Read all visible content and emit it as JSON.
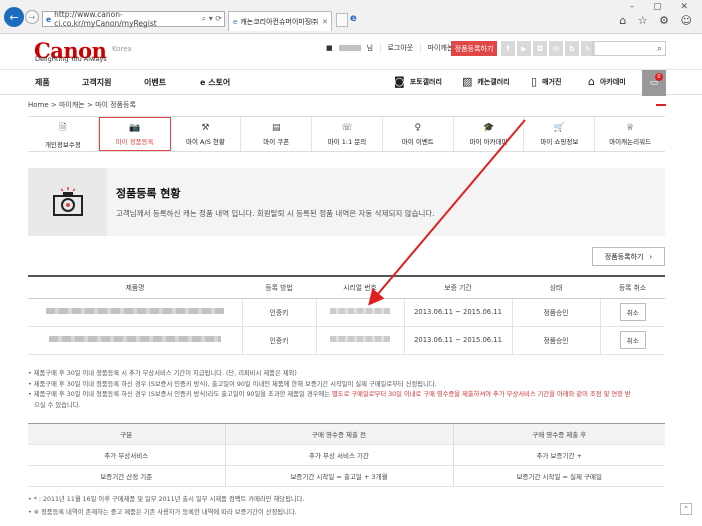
{
  "browser": {
    "url": "http://www.canon-ci.co.kr/myCanon/myRegist",
    "tab_title": "캐논코리아컨슈머이미징㈜",
    "window_controls": "–  ▢  ✕",
    "tools": "⌂ ☆ ⚙ ☺"
  },
  "header": {
    "logo": "Canon",
    "region": "Korea",
    "tagline": "Delighting You Always",
    "user_suffix": "님",
    "logout": "로그아웃",
    "mycanon": "마이캐논",
    "register_button": "정품등록하기",
    "sns": [
      "f",
      "▶",
      "◘",
      "✉",
      "b",
      "✎"
    ],
    "search_icon": "⌕"
  },
  "gnb": {
    "left": [
      "제품",
      "고객지원",
      "이벤트",
      "e 스토어"
    ],
    "right": [
      "포토갤러리",
      "캐논갤러리",
      "매거진",
      "아카데미"
    ],
    "cart_badge": "0"
  },
  "breadcrumb": "Home  >  마이캐논  >  마이 정품등록",
  "subnav": [
    {
      "label": "개인정보수정",
      "icon": "🗎"
    },
    {
      "label": "마이 정품등록",
      "icon": "📷",
      "active": true
    },
    {
      "label": "마이 A/S 현황",
      "icon": "⚒"
    },
    {
      "label": "마이 쿠폰",
      "icon": "▤"
    },
    {
      "label": "마이 1:1 문의",
      "icon": "☏"
    },
    {
      "label": "마이 이벤트",
      "icon": "♀"
    },
    {
      "label": "마이 아카데미",
      "icon": "🎓"
    },
    {
      "label": "마이 쇼핑정보",
      "icon": "🛒"
    },
    {
      "label": "마이캐논리워드",
      "icon": "♕"
    }
  ],
  "summary": {
    "title": "정품등록 현황",
    "desc": "고객님께서 등록하신 캐논 정품 내역 입니다. 회원탈퇴 시 등록된 정품 내역은 자동 삭제되지 않습니다."
  },
  "register_btn2": "정품등록하기",
  "table": {
    "headers": [
      "제품명",
      "등록 방법",
      "시리얼 번호",
      "보증 기간",
      "상태",
      "등록 취소"
    ],
    "rows": [
      {
        "method": "인증키",
        "period": "2013.06.11 ~ 2015.06.11",
        "status": "정품승인",
        "cancel": "취소"
      },
      {
        "method": "인증키",
        "period": "2013.06.11 ~ 2015.06.11",
        "status": "정품승인",
        "cancel": "취소"
      }
    ]
  },
  "notes": [
    "제품구매 후 30일 이내 정품등록 시 추가 무상서비스 기간이 지급됩니다. (단, 리퍼비시 제품은 제외)",
    "제품구매 후 30일 이내 정품등록 하신 경우 (S보증서 인증키 방식), 출고일이 90일 이내인 제품에 한해 보증기간 시작일이 실제 구매일로부터 산정됩니다.",
    "제품구매 후 30일 이내 정품등록 하신 경우 (S보증서 인증키 방식)라도 출고일이 90일을 초과한 제품일 경우에는 ",
    "별도로 구매일로부터 30일 이내로 구매 영수증을 제출하셔야 추가 무상서비스 기간을 아래와 같이 조정 및 연장 받",
    "으실 수 있습니다."
  ],
  "compare": {
    "headers": [
      "구분",
      "구매 영수증 제출 전",
      "구매 영수증 제출 후"
    ],
    "rows": [
      [
        "추가 무상서비스",
        "추가 무상 서비스 기간",
        "추가 보증기간 +"
      ],
      [
        "보증기간 산정 기준",
        "보증기간 시작일 = 출고일 + 3개월",
        "보증기간 시작일 = 실제 구매일"
      ]
    ]
  },
  "foot_notes": [
    "* : 2011년 11월 16일 이후 구매제품 및 일부 2011년 출시 일부 시제품 컴팩트 카메라만 해당됩니다.",
    "※ 정품등록 내역이 존재하는 중고 제품은 기존 사용자가 등록한 내역에 따라 보증기간이 산정됩니다."
  ],
  "colors": {
    "accent": "#e04848",
    "brand": "#cc0000",
    "annotation_arrow": "#e02020"
  }
}
